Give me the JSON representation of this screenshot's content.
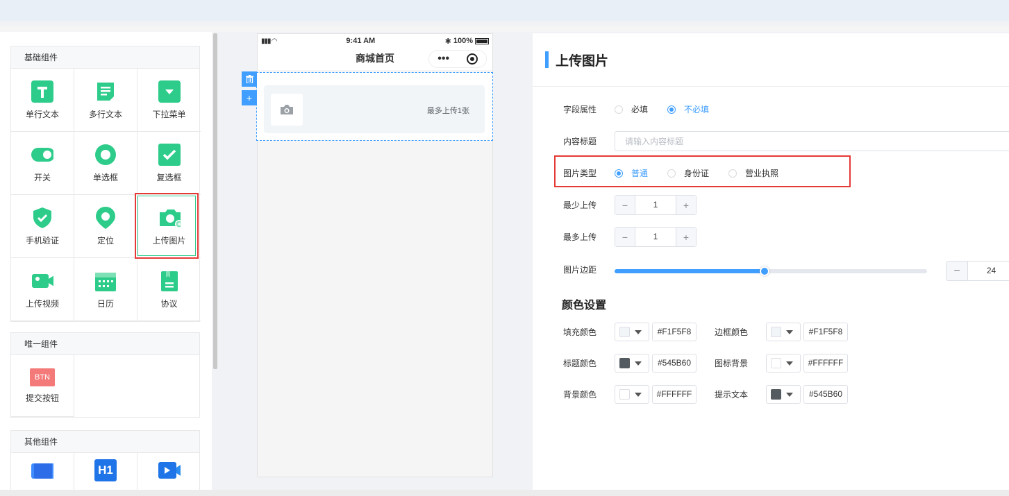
{
  "palette": {
    "groups": [
      {
        "title": "基础组件",
        "items": [
          {
            "label": "单行文本",
            "icon": "text-icon"
          },
          {
            "label": "多行文本",
            "icon": "multiline-text-icon"
          },
          {
            "label": "下拉菜单",
            "icon": "dropdown-icon"
          },
          {
            "label": "开关",
            "icon": "switch-icon"
          },
          {
            "label": "单选框",
            "icon": "radio-icon"
          },
          {
            "label": "复选框",
            "icon": "checkbox-icon"
          },
          {
            "label": "手机验证",
            "icon": "shield-check-icon"
          },
          {
            "label": "定位",
            "icon": "location-pin-icon"
          },
          {
            "label": "上传图片",
            "icon": "camera-icon"
          },
          {
            "label": "上传视频",
            "icon": "video-camera-icon"
          },
          {
            "label": "日历",
            "icon": "calendar-icon"
          },
          {
            "label": "协议",
            "icon": "agreement-icon"
          }
        ]
      },
      {
        "title": "唯一组件",
        "items": [
          {
            "label": "提交按钮",
            "icon": "submit-button-icon",
            "badge": "BTN"
          }
        ]
      },
      {
        "title": "其他组件",
        "items": [
          {
            "label": "",
            "icon": "banner-icon"
          },
          {
            "label": "",
            "icon": "heading-icon",
            "badge": "H1"
          },
          {
            "label": "",
            "icon": "video-play-icon"
          }
        ]
      }
    ]
  },
  "phone": {
    "time": "9:41 AM",
    "battery": "100%",
    "title": "商城首页",
    "upload_tip": "最多上传1张"
  },
  "panel": {
    "title": "上传图片",
    "field_attr": {
      "label": "字段属性",
      "options": [
        "必填",
        "不必填"
      ],
      "selected": "不必填"
    },
    "content_title": {
      "label": "内容标题",
      "placeholder": "请输入内容标题",
      "value": ""
    },
    "image_type": {
      "label": "图片类型",
      "options": [
        "普通",
        "身份证",
        "营业执照"
      ],
      "selected": "普通"
    },
    "min_upload": {
      "label": "最少上传",
      "value": "1"
    },
    "max_upload": {
      "label": "最多上传",
      "value": "1"
    },
    "image_margin": {
      "label": "图片边距",
      "value": "24",
      "slider_fraction": 0.48
    },
    "color_section": "颜色设置",
    "colors": [
      {
        "label": "填充颜色",
        "hex": "#F1F5F8"
      },
      {
        "label": "边框颜色",
        "hex": "#F1F5F8"
      },
      {
        "label": "标题颜色",
        "hex": "#545B60"
      },
      {
        "label": "图标背景",
        "hex": "#FFFFFF"
      },
      {
        "label": "背景颜色",
        "hex": "#FFFFFF"
      },
      {
        "label": "提示文本",
        "hex": "#545B60"
      }
    ]
  },
  "theme": {
    "accent": "#3f9eff",
    "green": "#2ecc8a",
    "highlight": "#e53935"
  }
}
